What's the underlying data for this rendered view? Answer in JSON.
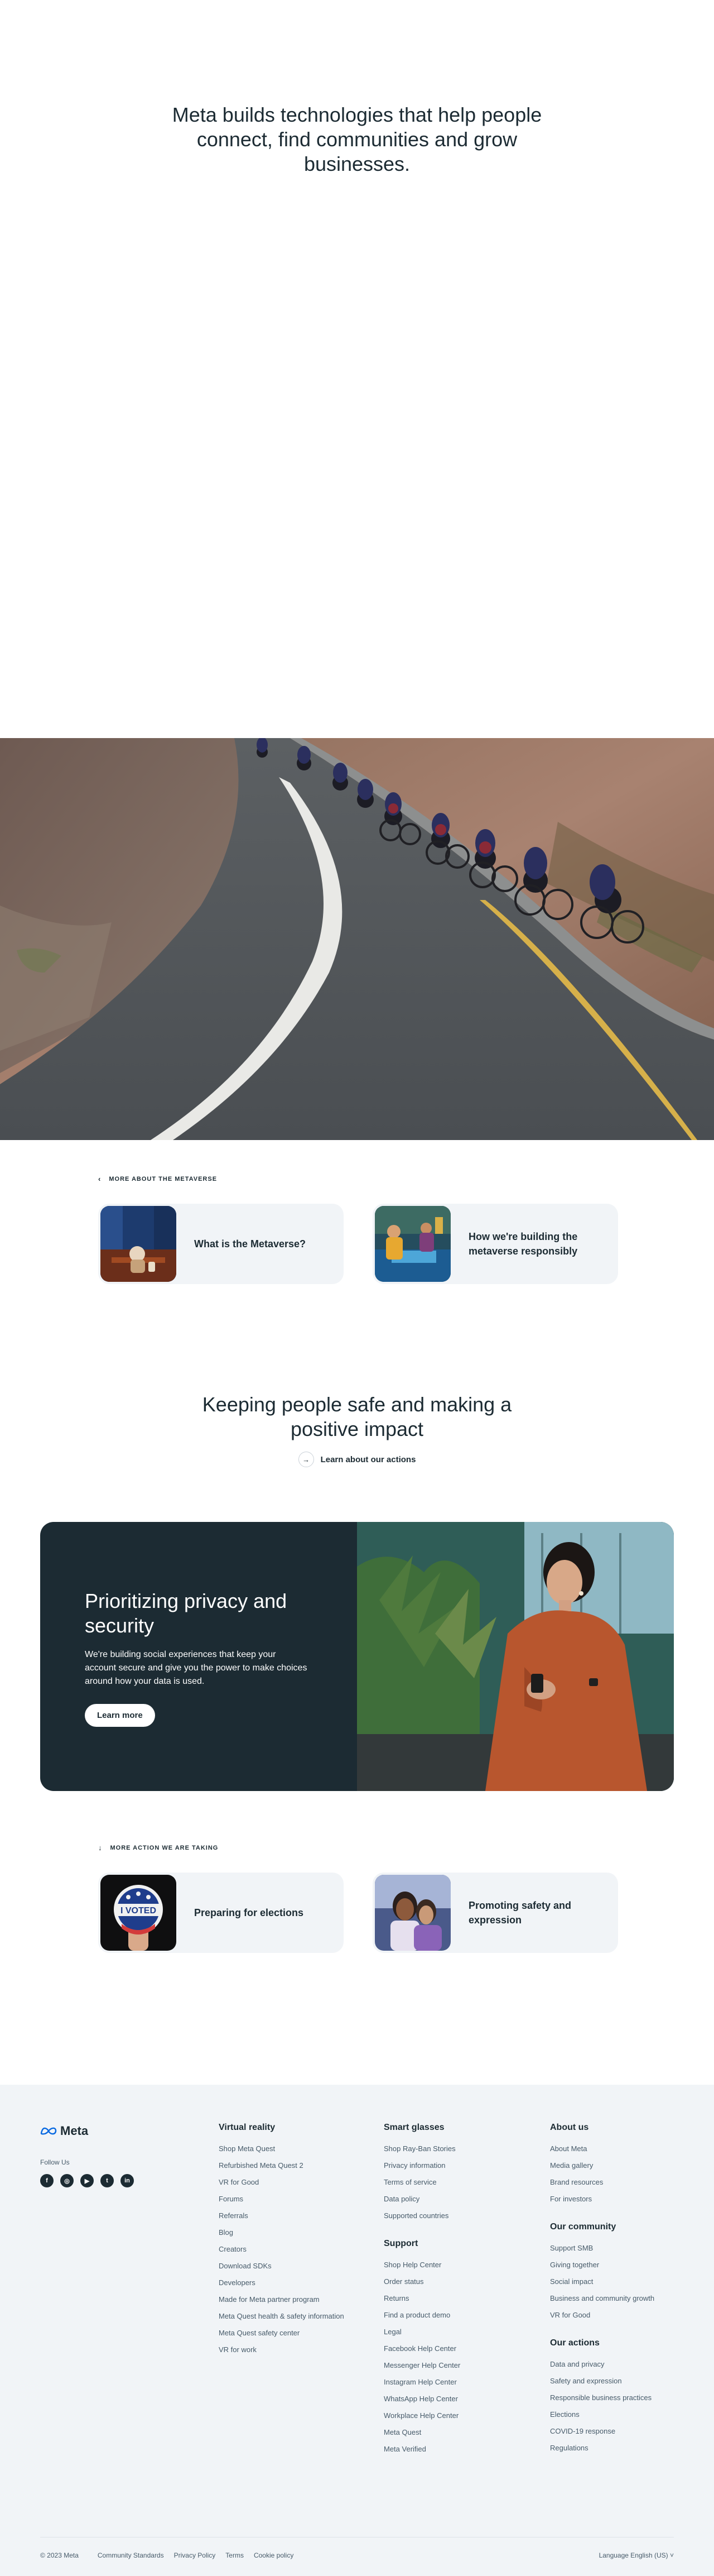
{
  "hero": {
    "headline": "Meta builds technologies that help people connect, find communities and grow businesses."
  },
  "metaverse": {
    "section_label": "More about the metaverse",
    "cards": [
      {
        "title": "What is the Metaverse?"
      },
      {
        "title": "How we're building the metaverse responsibly"
      }
    ]
  },
  "safety": {
    "headline": "Keeping people safe and making a positive impact",
    "link_label": "Learn about our actions"
  },
  "privacy": {
    "title": "Prioritizing privacy and security",
    "body": "We're building social experiences that keep your account secure and give you the power to make choices around how your data is used.",
    "button_label": "Learn more"
  },
  "actions": {
    "section_label": "More action we are taking",
    "cards": [
      {
        "title": "Preparing for elections",
        "badge_text": "I VOTED"
      },
      {
        "title": "Promoting safety and expression"
      }
    ]
  },
  "footer": {
    "logo_text": "Meta",
    "follow_label": "Follow Us",
    "socials": [
      "facebook-icon",
      "instagram-icon",
      "youtube-icon",
      "twitter-icon",
      "linkedin-icon"
    ],
    "columns": [
      {
        "groups": [
          {
            "heading": "Virtual reality",
            "links": [
              "Shop Meta Quest",
              "Refurbished Meta Quest 2",
              "VR for Good",
              "Forums",
              "Referrals",
              "Blog",
              "Creators",
              "Download SDKs",
              "Developers",
              "Made for Meta partner program",
              "Meta Quest health & safety information",
              "Meta Quest safety center",
              "VR for work"
            ]
          }
        ]
      },
      {
        "groups": [
          {
            "heading": "Smart glasses",
            "links": [
              "Shop Ray-Ban Stories",
              "Privacy information",
              "Terms of service",
              "Data policy",
              "Supported countries"
            ]
          },
          {
            "heading": "Support",
            "links": [
              "Shop Help Center",
              "Order status",
              "Returns",
              "Find a product demo",
              "Legal",
              "Facebook Help Center",
              "Messenger Help Center",
              "Instagram Help Center",
              "WhatsApp Help Center",
              "Workplace Help Center",
              "Meta Quest",
              "Meta Verified"
            ]
          }
        ]
      },
      {
        "groups": [
          {
            "heading": "About us",
            "links": [
              "About Meta",
              "Media gallery",
              "Brand resources",
              "For investors"
            ]
          },
          {
            "heading": "Our community",
            "links": [
              "Support SMB",
              "Giving together",
              "Social impact",
              "Business and community growth",
              "VR for Good"
            ]
          },
          {
            "heading": "Our actions",
            "links": [
              "Data and privacy",
              "Safety and expression",
              "Responsible business practices",
              "Elections",
              "COVID-19 response",
              "Regulations"
            ]
          }
        ]
      }
    ],
    "copyright": "© 2023 Meta",
    "bottom_links": [
      "Community Standards",
      "Privacy Policy",
      "Terms",
      "Cookie policy"
    ],
    "language": "Language English (US)"
  }
}
